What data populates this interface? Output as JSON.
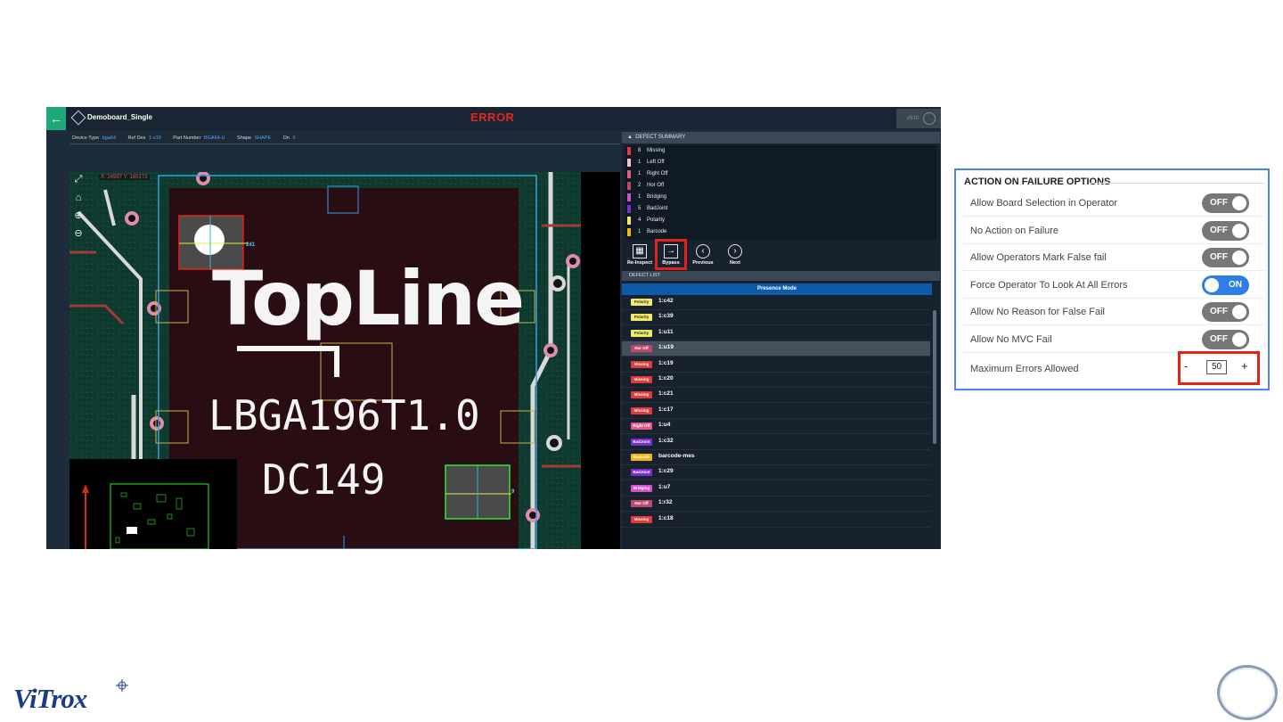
{
  "app": {
    "title": "Demoboard_Single",
    "status": "ERROR",
    "version": "v510"
  },
  "info": {
    "device_type_label": "Device Type",
    "device_type_value": "bga64",
    "ref_des_label": "Ref Des",
    "ref_des_value": "1:u19",
    "part_number_label": "Part Number",
    "part_number_value": "BGA64-U",
    "shape_label": "Shape",
    "shape_value": "SHAPE",
    "on_label": "On",
    "on_value": "0"
  },
  "viewer": {
    "coordinates": "X: 24997  Y: 165173",
    "chip_brand": "TopLine",
    "chip_line1": "LBGA196T1.0",
    "chip_line2": "DC149",
    "annot_241": "241",
    "annot_9": "9"
  },
  "defect_summary": {
    "header": "DEFECT SUMMARY",
    "items": [
      {
        "count": "8",
        "label": "Missing",
        "color": "#e23a3a"
      },
      {
        "count": "1",
        "label": "Left Off",
        "color": "#f4c4c4"
      },
      {
        "count": "1",
        "label": "Right Off",
        "color": "#e25a8a"
      },
      {
        "count": "2",
        "label": "Hor Off",
        "color": "#c04868"
      },
      {
        "count": "1",
        "label": "Bridging",
        "color": "#d451c9"
      },
      {
        "count": "5",
        "label": "BadJoint",
        "color": "#7b2fc9"
      },
      {
        "count": "4",
        "label": "Polarity",
        "color": "#f2e86a"
      },
      {
        "count": "1",
        "label": "Barcode",
        "color": "#f2b60e"
      }
    ]
  },
  "actions": {
    "reinspect": "Re-Inspect",
    "bypass": "Bypass",
    "previous": "Previous",
    "next": "Next"
  },
  "defect_list": {
    "header": "DEFECT LIST",
    "mode": "Presence Mode",
    "rows": [
      {
        "badge": "Polarity",
        "color": "#f2e86a",
        "text": "1:c42"
      },
      {
        "badge": "Polarity",
        "color": "#f2e86a",
        "text": "1:c39"
      },
      {
        "badge": "Polarity",
        "color": "#f2e86a",
        "text": "1:u11"
      },
      {
        "badge": "Hor Off",
        "color": "#c04868",
        "text": "1:u19"
      },
      {
        "badge": "Missing",
        "color": "#e23a3a",
        "text": "1:c19"
      },
      {
        "badge": "Missing",
        "color": "#e23a3a",
        "text": "1:c20"
      },
      {
        "badge": "Missing",
        "color": "#e23a3a",
        "text": "1:c21"
      },
      {
        "badge": "Missing",
        "color": "#e23a3a",
        "text": "1:c17"
      },
      {
        "badge": "Right Off",
        "color": "#e25a8a",
        "text": "1:u4"
      },
      {
        "badge": "BadJoint",
        "color": "#7b2fc9",
        "text": "1:c32"
      },
      {
        "badge": "Barcode",
        "color": "#f2b60e",
        "text": "barcode-mes"
      },
      {
        "badge": "BadJoint",
        "color": "#7b2fc9",
        "text": "1:c29"
      },
      {
        "badge": "Bridging",
        "color": "#d451c9",
        "text": "1:u7"
      },
      {
        "badge": "Hor Off",
        "color": "#c04868",
        "text": "1:r32"
      },
      {
        "badge": "Missing",
        "color": "#e23a3a",
        "text": "1:c18"
      }
    ]
  },
  "options": {
    "title": "ACTION ON FAILURE OPTIONS",
    "rows": [
      {
        "label": "Allow Board Selection in Operator",
        "state": "OFF"
      },
      {
        "label": "No Action on Failure",
        "state": "OFF"
      },
      {
        "label": "Allow Operators Mark False fail",
        "state": "OFF"
      },
      {
        "label": "Force Operator To Look At All Errors",
        "state": "ON"
      },
      {
        "label": "Allow No Reason for False Fail",
        "state": "OFF"
      },
      {
        "label": "Allow No MVC Fail",
        "state": "OFF"
      }
    ],
    "max_errors_label": "Maximum Errors Allowed",
    "max_errors_value": "50",
    "minus": "-",
    "plus": "+"
  },
  "footer": {
    "logo": "ViTrox"
  },
  "colors": {
    "accent_green": "#1fa87a",
    "error_red": "#e52521",
    "highlight_red": "#e2231a",
    "toggle_on": "#2f7ee8",
    "toggle_off": "#777777"
  }
}
